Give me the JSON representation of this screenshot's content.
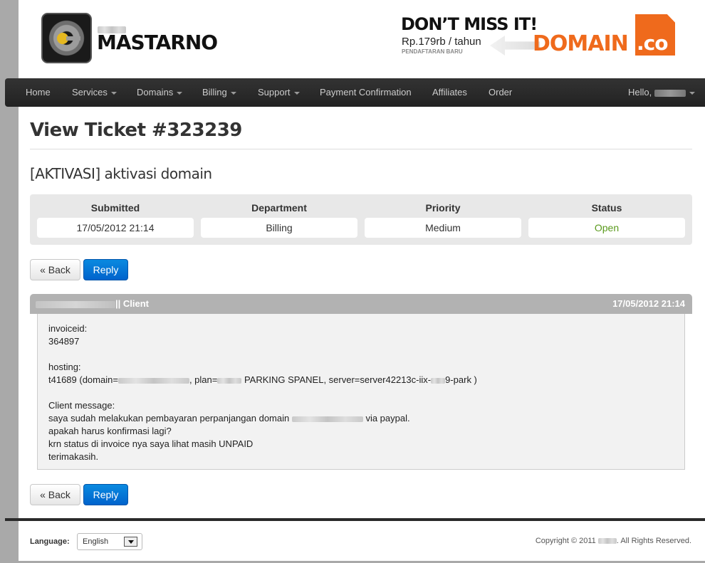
{
  "header": {
    "brand": "MASTARNO",
    "ad": {
      "headline": "DON’T MISS IT!",
      "price": "Rp.179rb / tahun",
      "subtitle": "PENDAFTARAN BARU",
      "domain_text": "DOMAIN",
      "tld_text": ".co",
      "accent_color": "#ef6a1c"
    }
  },
  "nav": {
    "items": [
      {
        "label": "Home",
        "dropdown": false
      },
      {
        "label": "Services",
        "dropdown": true
      },
      {
        "label": "Domains",
        "dropdown": true
      },
      {
        "label": "Billing",
        "dropdown": true
      },
      {
        "label": "Support",
        "dropdown": true
      },
      {
        "label": "Payment Confirmation",
        "dropdown": false
      },
      {
        "label": "Affiliates",
        "dropdown": false
      },
      {
        "label": "Order",
        "dropdown": false
      }
    ],
    "hello": "Hello,"
  },
  "ticket": {
    "title": "View Ticket #323239",
    "subject": "[AKTIVASI] aktivasi domain",
    "info": [
      {
        "label": "Submitted",
        "value": "17/05/2012 21:14"
      },
      {
        "label": "Department",
        "value": "Billing"
      },
      {
        "label": "Priority",
        "value": "Medium"
      },
      {
        "label": "Status",
        "value": "Open"
      }
    ],
    "status_color": "#5a9a1c",
    "buttons": {
      "back": "« Back",
      "reply": "Reply"
    }
  },
  "message": {
    "author_role": "|| Client",
    "date": "17/05/2012 21:14",
    "lines": {
      "l1": "invoiceid:",
      "l2": "364897",
      "l3": "hosting:",
      "l4a": "t41689 (domain=",
      "l4b": ", plan=",
      "l4c": " PARKING SPANEL, server=server42213c-iix-",
      "l4d": "9-park )",
      "l5": "Client message:",
      "l6a": "saya sudah melakukan pembayaran perpanjangan domain ",
      "l6b": " via paypal.",
      "l7": "apakah harus konfirmasi lagi?",
      "l8": "krn status di invoice nya saya lihat masih UNPAID",
      "l9": "terimakasih."
    }
  },
  "footer": {
    "language_label": "Language:",
    "language_value": "English",
    "copyright_prefix": "Copyright © 2011",
    "copyright_suffix": ". All Rights Reserved."
  }
}
